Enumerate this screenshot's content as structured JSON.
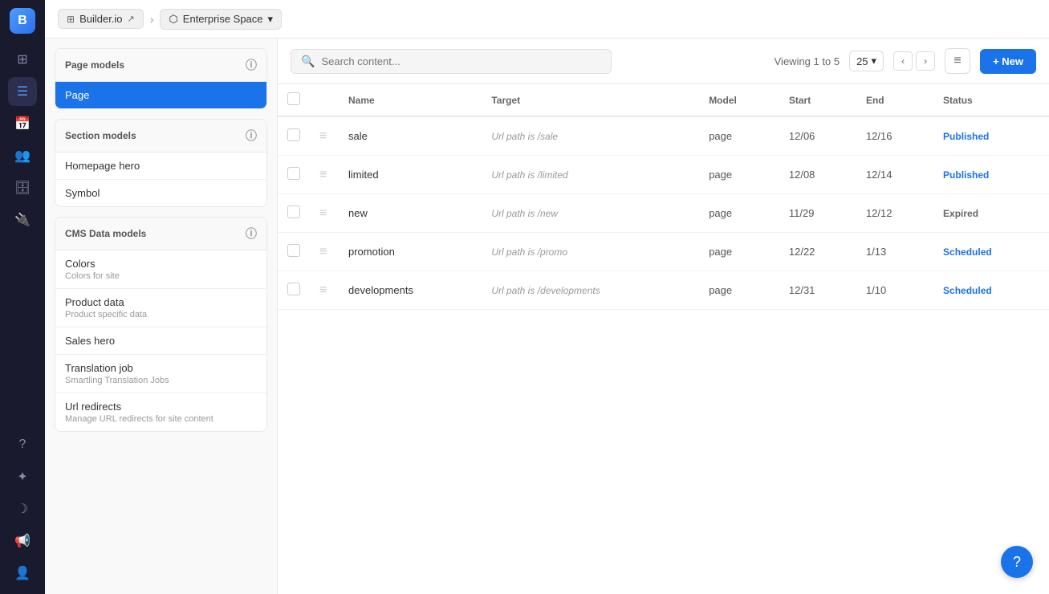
{
  "topbar": {
    "builder_label": "Builder.io",
    "space_label": "Enterprise Space",
    "chevron": "›"
  },
  "sidebar": {
    "icons": [
      {
        "name": "grid-icon",
        "symbol": "⊞",
        "active": false
      },
      {
        "name": "content-icon",
        "symbol": "☰",
        "active": true
      },
      {
        "name": "calendar-icon",
        "symbol": "📅",
        "active": false
      },
      {
        "name": "people-icon",
        "symbol": "👥",
        "active": false
      },
      {
        "name": "data-icon",
        "symbol": "🗄",
        "active": false
      },
      {
        "name": "plugin-icon",
        "symbol": "🔌",
        "active": false
      }
    ],
    "bottom_icons": [
      {
        "name": "help-icon",
        "symbol": "?"
      },
      {
        "name": "star-icon",
        "symbol": "✦"
      },
      {
        "name": "moon-icon",
        "symbol": "☽"
      },
      {
        "name": "announce-icon",
        "symbol": "📢"
      },
      {
        "name": "user-icon",
        "symbol": "👤"
      }
    ]
  },
  "page_models_section": {
    "title": "Page models",
    "items": [
      {
        "label": "Page",
        "active": true
      }
    ]
  },
  "section_models_section": {
    "title": "Section models",
    "items": [
      {
        "label": "Homepage hero",
        "subtitle": ""
      },
      {
        "label": "Symbol",
        "subtitle": ""
      }
    ]
  },
  "cms_data_section": {
    "title": "CMS Data models",
    "items": [
      {
        "label": "Colors",
        "subtitle": "Colors for site"
      },
      {
        "label": "Product data",
        "subtitle": "Product specific data"
      },
      {
        "label": "Sales hero",
        "subtitle": ""
      },
      {
        "label": "Translation job",
        "subtitle": "Smartling Translation Jobs"
      },
      {
        "label": "Url redirects",
        "subtitle": "Manage URL redirects for site content"
      }
    ]
  },
  "toolbar": {
    "search_placeholder": "Search content...",
    "viewing_text": "Viewing 1 to 5",
    "per_page": "25",
    "new_button": "+ New",
    "filter_icon": "filter-icon"
  },
  "table": {
    "columns": [
      "",
      "",
      "Name",
      "Target",
      "Model",
      "Start",
      "End",
      "Status"
    ],
    "rows": [
      {
        "name": "sale",
        "target": "Url path is /sale",
        "model": "page",
        "start": "12/06",
        "end": "12/16",
        "status": "Published",
        "status_class": "status-published"
      },
      {
        "name": "limited",
        "target": "Url path is /limited",
        "model": "page",
        "start": "12/08",
        "end": "12/14",
        "status": "Published",
        "status_class": "status-published"
      },
      {
        "name": "new",
        "target": "Url path is /new",
        "model": "page",
        "start": "11/29",
        "end": "12/12",
        "status": "Expired",
        "status_class": "status-expired"
      },
      {
        "name": "promotion",
        "target": "Url path is /promo",
        "model": "page",
        "start": "12/22",
        "end": "1/13",
        "status": "Scheduled",
        "status_class": "status-scheduled"
      },
      {
        "name": "developments",
        "target": "Url path is /developments",
        "model": "page",
        "start": "12/31",
        "end": "1/10",
        "status": "Scheduled",
        "status_class": "status-scheduled"
      }
    ]
  },
  "help_button": "?"
}
